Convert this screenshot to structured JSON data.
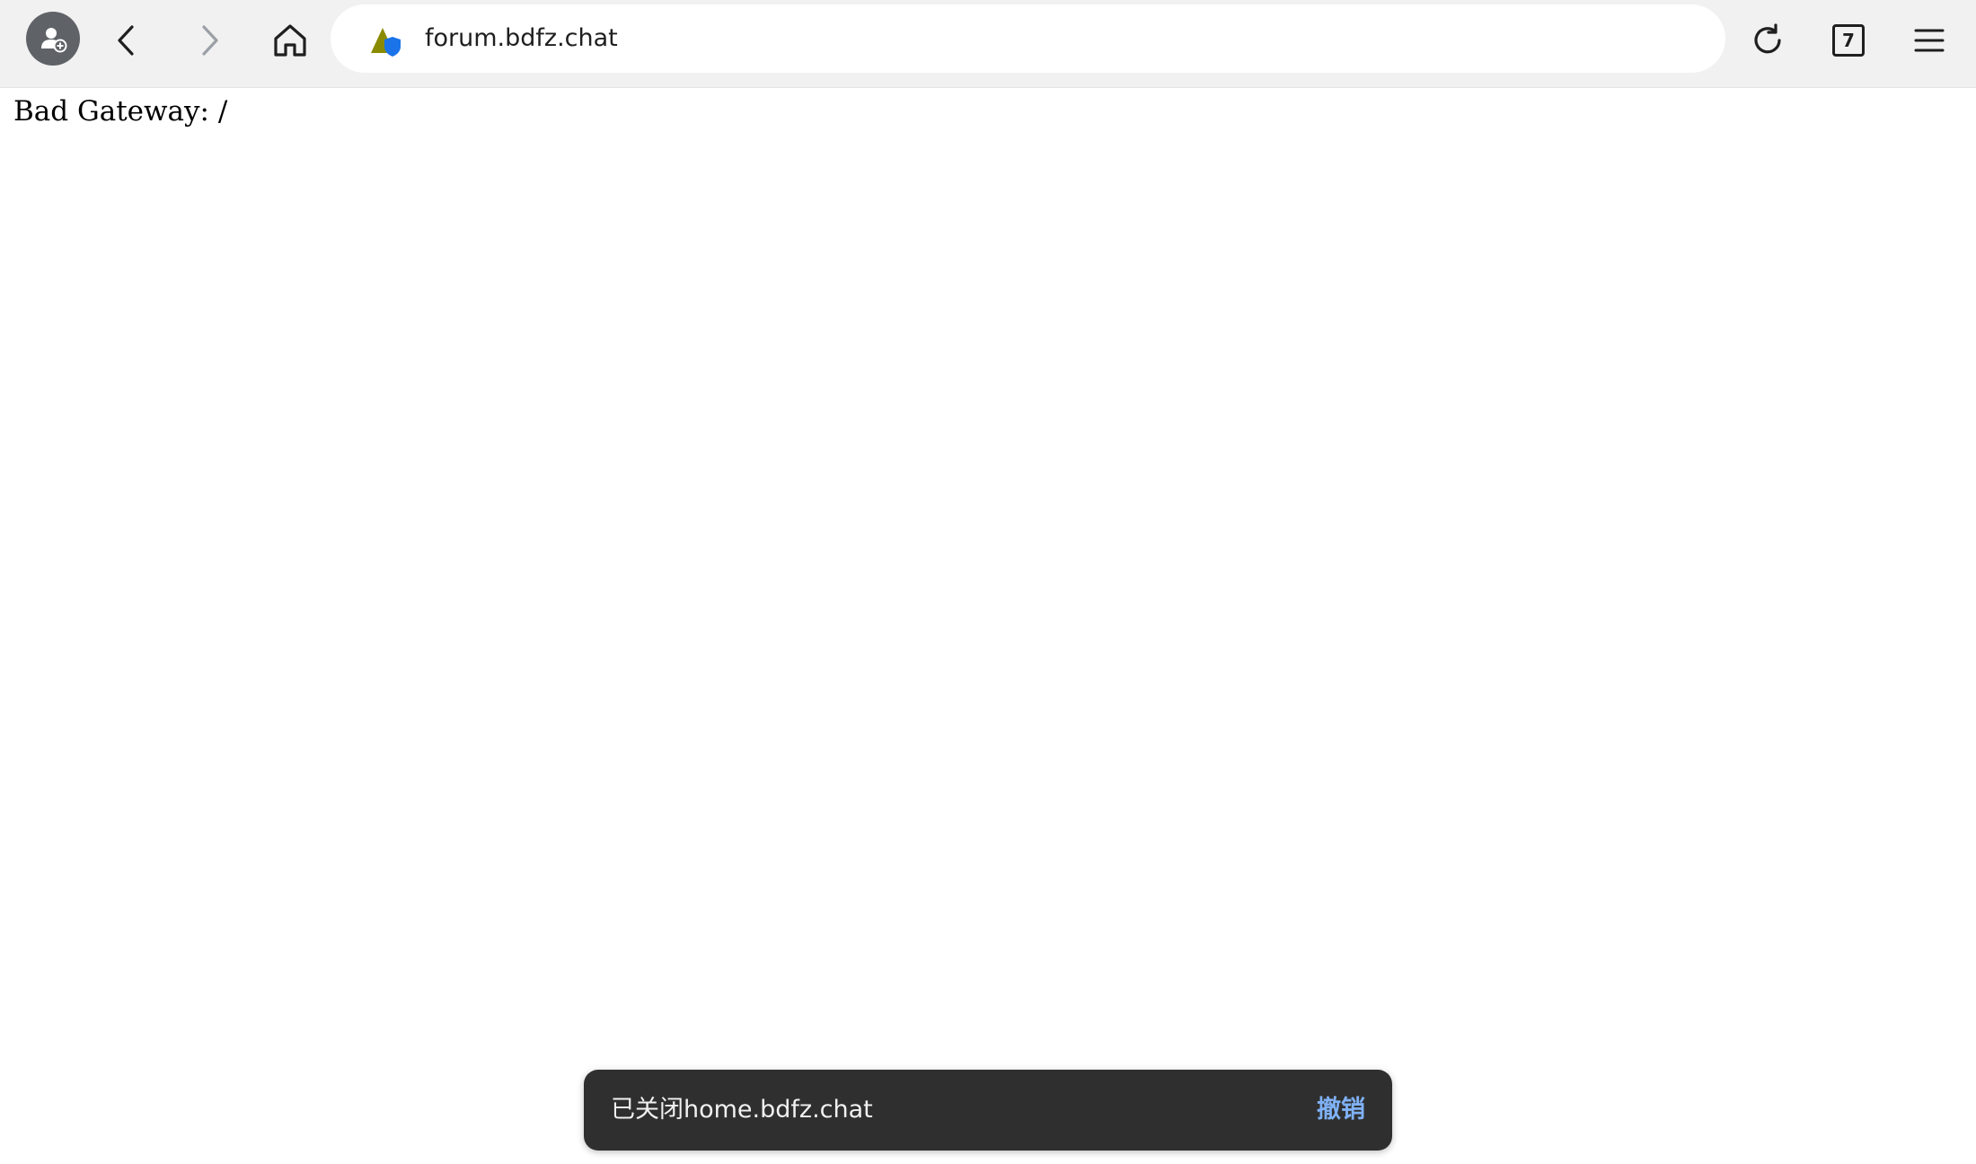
{
  "browser": {
    "url": "forum.bdfz.chat",
    "tab_count": "7",
    "icons": {
      "profile": "profile-avatar-icon",
      "back": "chevron-left-icon",
      "forward": "chevron-right-icon",
      "home": "home-icon",
      "site": "site-security-icon",
      "bookmark": "star-icon",
      "reload": "reload-icon",
      "tabs": "tab-switcher-icon",
      "menu": "hamburger-menu-icon"
    }
  },
  "page": {
    "error_text": "Bad Gateway: /"
  },
  "snackbar": {
    "message": "已关闭home.bdfz.chat",
    "action_label": "撤销"
  },
  "colors": {
    "toolbar_bg": "#f1f1f1",
    "omnibox_bg": "#ffffff",
    "snackbar_bg": "#2f2f2f",
    "snackbar_action": "#7fb1f5",
    "forward_disabled": "#9aa0a6"
  }
}
